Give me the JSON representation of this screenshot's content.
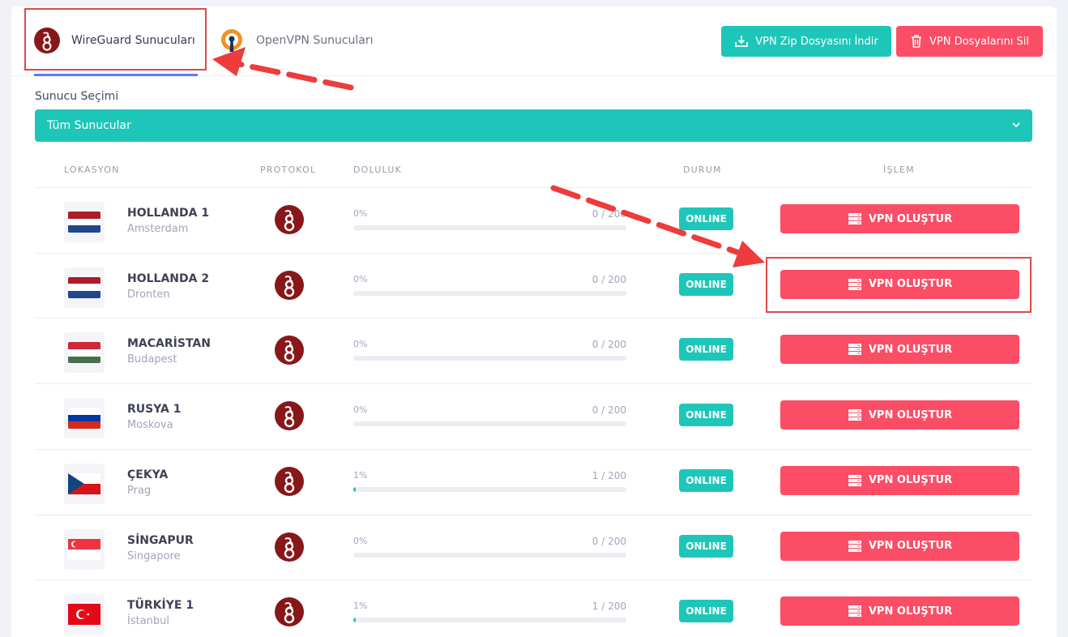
{
  "tabs": [
    {
      "label": "WireGuard Sunucuları",
      "active": true
    },
    {
      "label": "OpenVPN Sunucuları",
      "active": false
    }
  ],
  "actions": {
    "zip_label": "VPN Zip Dosyasını İndir",
    "delete_label": "VPN Dosyalarını Sil"
  },
  "server_select": {
    "label": "Sunucu Seçimi",
    "value": "Tüm Sunucular"
  },
  "table": {
    "headers": {
      "location": "LOKASYON",
      "protocol": "PROTOKOL",
      "usage": "DOLULUK",
      "status": "DURUM",
      "action": "İŞLEM"
    },
    "rows": [
      {
        "name": "HOLLANDA 1",
        "city": "Amsterdam",
        "percent": "0%",
        "count": "0 / 200",
        "fill": 0,
        "status": "ONLINE",
        "action": "VPN OLUŞTUR",
        "flag": [
          "#ae1c28",
          "#ffffff",
          "#21468b"
        ]
      },
      {
        "name": "HOLLANDA 2",
        "city": "Dronten",
        "percent": "0%",
        "count": "0 / 200",
        "fill": 0,
        "status": "ONLINE",
        "action": "VPN OLUŞTUR",
        "flag": [
          "#ae1c28",
          "#ffffff",
          "#21468b"
        ]
      },
      {
        "name": "MACARİSTAN",
        "city": "Budapest",
        "percent": "0%",
        "count": "0 / 200",
        "fill": 0,
        "status": "ONLINE",
        "action": "VPN OLUŞTUR",
        "flag": [
          "#ce2939",
          "#ffffff",
          "#477050"
        ]
      },
      {
        "name": "RUSYA 1",
        "city": "Moskova",
        "percent": "0%",
        "count": "0 / 200",
        "fill": 0,
        "status": "ONLINE",
        "action": "VPN OLUŞTUR",
        "flag": [
          "#ffffff",
          "#0039a6",
          "#d52b1e"
        ]
      },
      {
        "name": "ÇEKYA",
        "city": "Prag",
        "percent": "1%",
        "count": "1 / 200",
        "fill": 0.01,
        "status": "ONLINE",
        "action": "VPN OLUŞTUR",
        "flag": [
          "#ffffff",
          "#d7141a",
          "#11457e"
        ]
      },
      {
        "name": "SİNGAPUR",
        "city": "Singapore",
        "percent": "0%",
        "count": "0 / 200",
        "fill": 0,
        "status": "ONLINE",
        "action": "VPN OLUŞTUR",
        "flag": [
          "#ef3340",
          "#ffffff"
        ]
      },
      {
        "name": "TÜRKİYE 1",
        "city": "İstanbul",
        "percent": "1%",
        "count": "1 / 200",
        "fill": 0.01,
        "status": "ONLINE",
        "action": "VPN OLUŞTUR",
        "flag": [
          "#e30a17"
        ]
      }
    ]
  },
  "colors": {
    "accent": "#1ec6b9",
    "danger": "#fb4d65",
    "highlight": "#e04848",
    "wireguard": "#88171a",
    "openvpn_orange": "#f29125",
    "openvpn_navy": "#1b2f60"
  }
}
